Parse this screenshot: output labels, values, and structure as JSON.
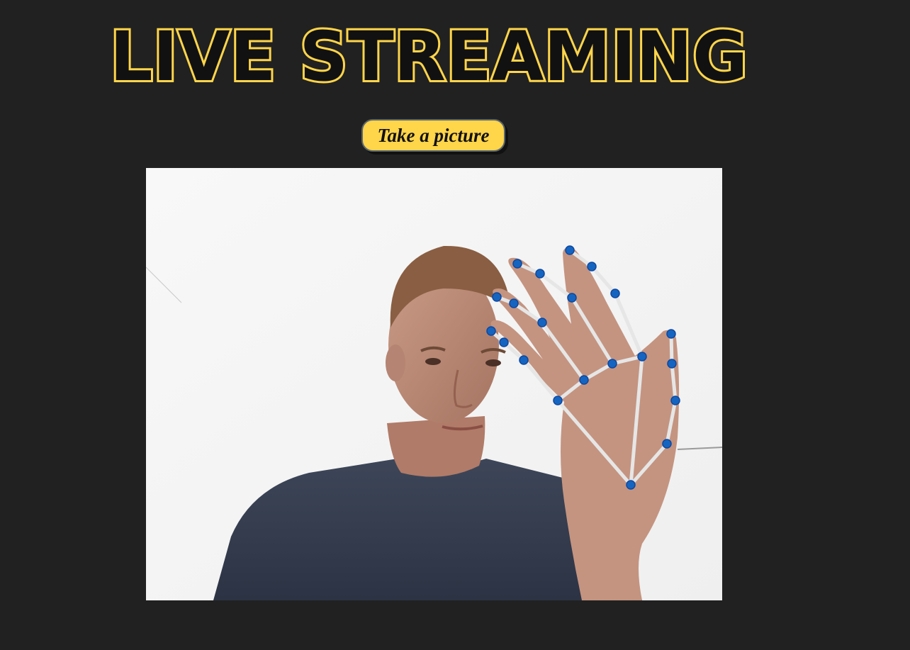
{
  "header": {
    "title": "LIVE STREAMING",
    "title_fill": "#111111",
    "title_outline": "#ffd54a"
  },
  "controls": {
    "capture_label": "Take a picture"
  },
  "colors": {
    "page_background": "#212121",
    "button_background": "#ffd54a",
    "landmark_point": "#1565c0",
    "landmark_line": "#e6e6e6",
    "frame_background": "#f6f6f6"
  },
  "video": {
    "content": "live webcam feed with hand landmark overlay",
    "landmark_count": 21
  }
}
